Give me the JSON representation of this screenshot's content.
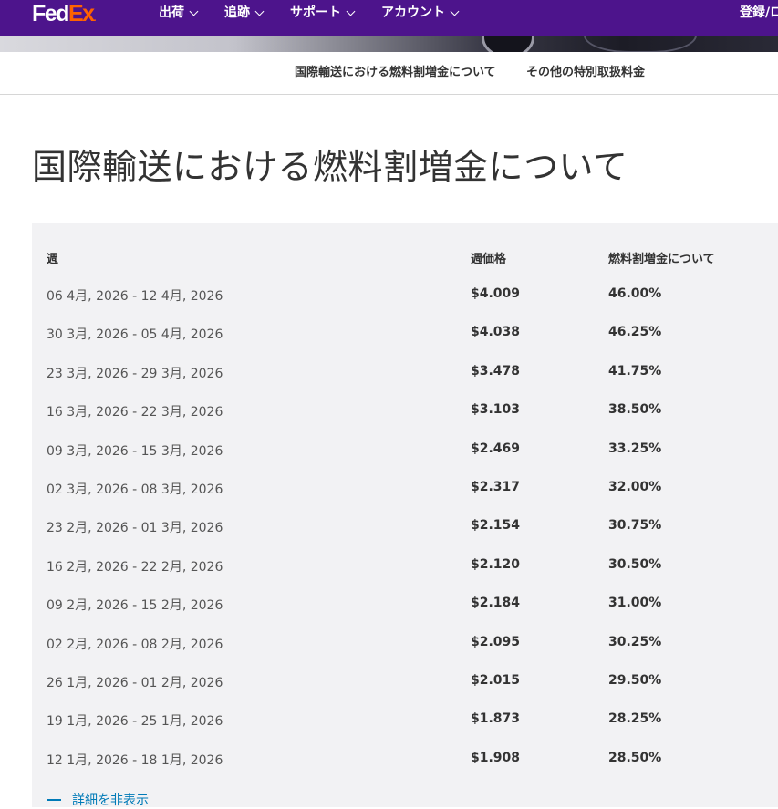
{
  "header": {
    "logo_fed": "Fed",
    "logo_ex": "Ex",
    "logo_dot": ".",
    "nav": [
      {
        "label": "出荷"
      },
      {
        "label": "追跡"
      },
      {
        "label": "サポート"
      },
      {
        "label": "アカウント"
      }
    ],
    "login": "登録/ロ"
  },
  "subnav": {
    "items": [
      {
        "label": "国際輸送における燃料割増金について"
      },
      {
        "label": "その他の特別取扱料金"
      }
    ]
  },
  "page": {
    "title": "国際輸送における燃料割増金について"
  },
  "table": {
    "headers": [
      "週",
      "週価格",
      "燃料割増金について"
    ],
    "rows": [
      [
        "06 4月, 2026 - 12 4月, 2026",
        "$4.009",
        "46.00%"
      ],
      [
        "30 3月, 2026 - 05 4月, 2026",
        "$4.038",
        "46.25%"
      ],
      [
        "23 3月, 2026 - 29 3月, 2026",
        "$3.478",
        "41.75%"
      ],
      [
        "16 3月, 2026 - 22 3月, 2026",
        "$3.103",
        "38.50%"
      ],
      [
        "09 3月, 2026 - 15 3月, 2026",
        "$2.469",
        "33.25%"
      ],
      [
        "02 3月, 2026 - 08 3月, 2026",
        "$2.317",
        "32.00%"
      ],
      [
        "23 2月, 2026 - 01 3月, 2026",
        "$2.154",
        "30.75%"
      ],
      [
        "16 2月, 2026 - 22 2月, 2026",
        "$2.120",
        "30.50%"
      ],
      [
        "09 2月, 2026 - 15 2月, 2026",
        "$2.184",
        "31.00%"
      ],
      [
        "02 2月, 2026 - 08 2月, 2026",
        "$2.095",
        "30.25%"
      ],
      [
        "26 1月, 2026 - 01 2月, 2026",
        "$2.015",
        "29.50%"
      ],
      [
        "19 1月, 2026 - 25 1月, 2026",
        "$1.873",
        "28.25%"
      ],
      [
        "12 1月, 2026 - 18 1月, 2026",
        "$1.908",
        "28.50%"
      ]
    ],
    "toggle_label": "詳細を非表示"
  },
  "colors": {
    "brand_purple": "#4d148c",
    "brand_orange": "#ff6200",
    "link_blue": "#007ab7",
    "panel_bg": "#f2f2f4"
  }
}
